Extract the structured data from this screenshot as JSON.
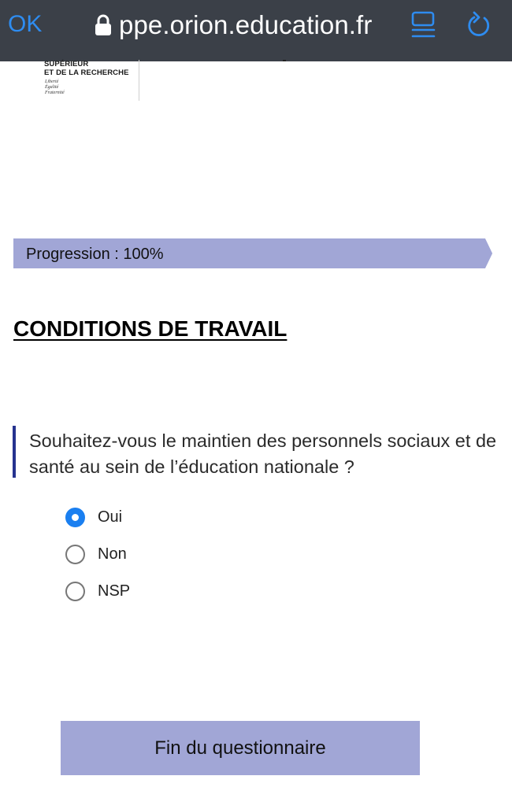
{
  "browser": {
    "done_label": "OK",
    "url": "ppe.orion.education.fr",
    "accent_color": "#2e8cf0",
    "icons": [
      "lock-icon",
      "reader-mode-icon",
      "reload-icon"
    ]
  },
  "logo": {
    "line1": "SUPÉRIEUR",
    "line2": "ET DE LA RECHERCHE",
    "motto": [
      "Liberté",
      "Égalité",
      "Fraternité"
    ]
  },
  "progress": {
    "label": "Progression : 100%",
    "percent": 100,
    "color": "#a1a6d6"
  },
  "section": {
    "title": "CONDITIONS DE TRAVAIL"
  },
  "question": {
    "text": "Souhaitez-vous le maintien des personnels sociaux et de santé au sein de l’éducation nationale ?",
    "accent_color": "#26338f",
    "options": [
      {
        "label": "Oui",
        "selected": true
      },
      {
        "label": "Non",
        "selected": false
      },
      {
        "label": "NSP",
        "selected": false
      }
    ]
  },
  "footer": {
    "finish_label": "Fin du questionnaire"
  }
}
